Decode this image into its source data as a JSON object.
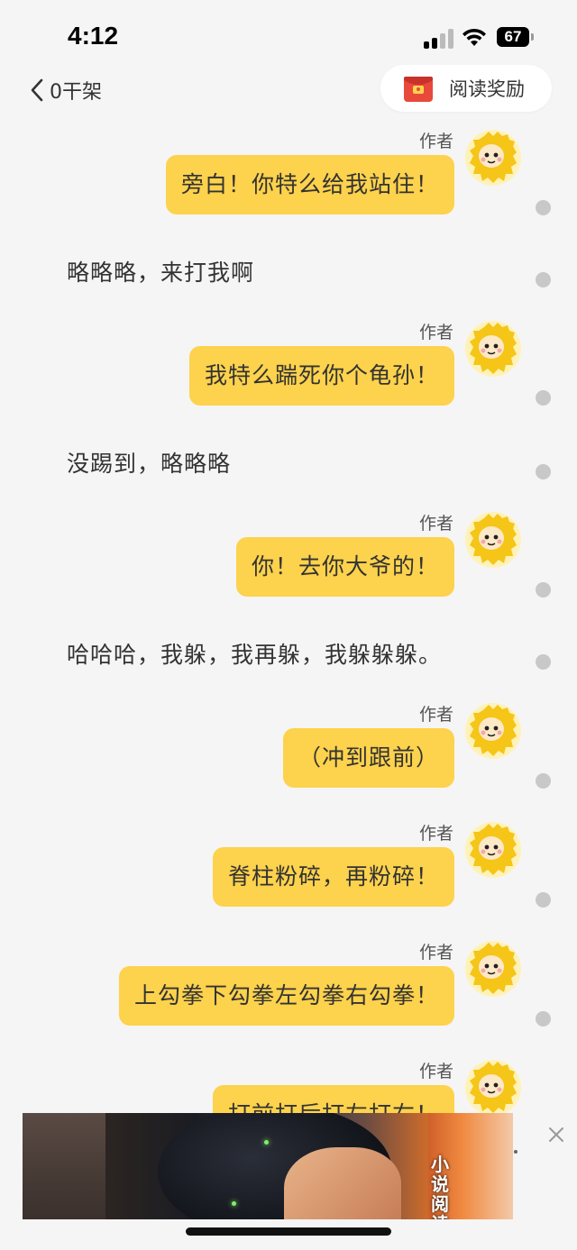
{
  "status": {
    "time": "4:12",
    "battery": "67"
  },
  "nav": {
    "back_label": "0干架",
    "reward_label": "阅读奖励"
  },
  "chat": {
    "author_label": "作者",
    "messages": [
      {
        "type": "author",
        "text": "旁白！你特么给我站住！"
      },
      {
        "type": "narr",
        "text": "略略略，来打我啊"
      },
      {
        "type": "author",
        "text": "我特么踹死你个龟孙！"
      },
      {
        "type": "narr",
        "text": "没踢到，略略略"
      },
      {
        "type": "author",
        "text": "你！去你大爷的！"
      },
      {
        "type": "narr",
        "text": "哈哈哈，我躲，我再躲，我躲躲躲。"
      },
      {
        "type": "author",
        "text": "（冲到跟前）"
      },
      {
        "type": "author",
        "text": "脊柱粉碎，再粉碎！"
      },
      {
        "type": "author",
        "text": "上勾拳下勾拳左勾拳右勾拳！"
      },
      {
        "type": "author",
        "text": "打前打后打左打右！"
      }
    ]
  },
  "ad": {
    "title": "小说阅读"
  },
  "colors": {
    "bubble": "#fdd24c",
    "background": "#f5f5f5"
  }
}
